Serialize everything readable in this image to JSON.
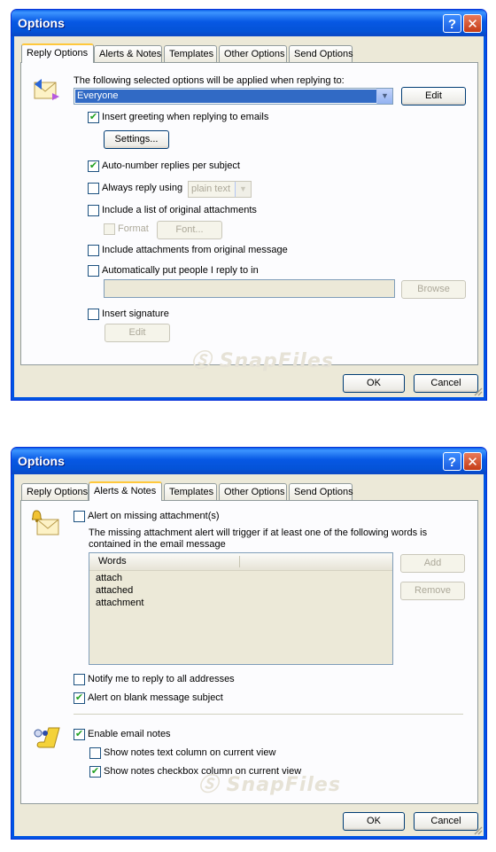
{
  "dialog1": {
    "title": "Options",
    "help_glyph": "?",
    "close_glyph": "✕",
    "tabs": [
      "Reply Options",
      "Alerts & Notes",
      "Templates",
      "Other Options",
      "Send Options"
    ],
    "active_tab": "Reply Options",
    "intro": "The following selected options will be applied when replying to:",
    "recipient_select": "Everyone",
    "edit_button": "Edit",
    "insert_greeting": "Insert greeting when replying to emails",
    "settings_button": "Settings...",
    "auto_number": "Auto-number replies per subject",
    "always_reply": "Always reply using",
    "format_select": "plain text",
    "include_list": "Include a list of original attachments",
    "format_label": "Format",
    "font_button": "Font...",
    "include_attachments": "Include attachments from original message",
    "auto_put": "Automatically put people I reply to in",
    "browse_button": "Browse",
    "insert_signature": "Insert signature",
    "edit_signature_button": "Edit",
    "watermark": "SnapFiles",
    "ok_button": "OK",
    "cancel_button": "Cancel",
    "checkmark": "✔",
    "dropdown_arrow": "▼"
  },
  "dialog2": {
    "title": "Options",
    "help_glyph": "?",
    "close_glyph": "✕",
    "tabs": [
      "Reply Options",
      "Alerts & Notes",
      "Templates",
      "Other Options",
      "Send Options"
    ],
    "active_tab": "Alerts & Notes",
    "alert_missing": "Alert on missing attachment(s)",
    "alert_desc": "The missing attachment alert will trigger if at least one of the following words is contained in the email message",
    "words_header": "Words",
    "words": [
      "attach",
      "attached",
      "attachment"
    ],
    "add_button": "Add",
    "remove_button": "Remove",
    "notify_reply_all": "Notify me to reply to all addresses",
    "alert_blank_subject": "Alert on blank message subject",
    "enable_notes": "Enable email notes",
    "show_notes_text": "Show notes text column on current view",
    "show_notes_checkbox": "Show notes checkbox column on current view",
    "watermark": "SnapFiles",
    "ok_button": "OK",
    "cancel_button": "Cancel",
    "checkmark": "✔"
  }
}
